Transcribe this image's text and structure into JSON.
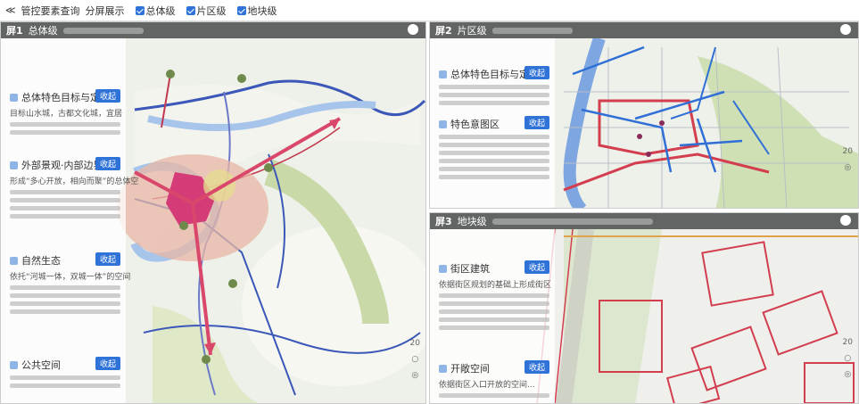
{
  "topbar": {
    "back_label": "≪",
    "title": "管控要素查询",
    "mode": "分屏展示",
    "checkboxes": [
      {
        "label": "总体级",
        "checked": true
      },
      {
        "label": "片区级",
        "checked": true
      },
      {
        "label": "地块级",
        "checked": true
      }
    ]
  },
  "panels": [
    {
      "num": "屏1",
      "level": "总体级",
      "sections": [
        {
          "title": "总体特色目标与定位",
          "btn": "收起",
          "text": "目标山水城，古都文化城，宜居"
        },
        {
          "title": "外部景观·内部边界",
          "btn": "收起",
          "text": "形成“多心开放，相向而聚”的总体空"
        },
        {
          "title": "自然生态",
          "btn": "收起",
          "text": "依托“河城一体，双城一体”的空间"
        },
        {
          "title": "公共空间",
          "btn": "收起",
          "text": ""
        }
      ],
      "tools": [
        "20",
        "○",
        "◎"
      ]
    },
    {
      "num": "屏2",
      "level": "片区级",
      "sections": [
        {
          "title": "总体特色目标与定位",
          "btn": "收起",
          "text": ""
        },
        {
          "title": "特色意图区",
          "btn": "收起",
          "text": ""
        }
      ],
      "tools": [
        "20",
        "◎"
      ]
    },
    {
      "num": "屏3",
      "level": "地块级",
      "sections": [
        {
          "title": "街区建筑",
          "btn": "收起",
          "text": "依据街区规划的基础上形成街区"
        },
        {
          "title": "开敞空间",
          "btn": "收起",
          "text": "依据街区入口开放的空间..."
        }
      ],
      "tools": [
        "20",
        "○",
        "◎"
      ]
    }
  ],
  "colors": {
    "accent": "#2f73d8",
    "header": "#464646",
    "arrow": "#d9476a"
  }
}
